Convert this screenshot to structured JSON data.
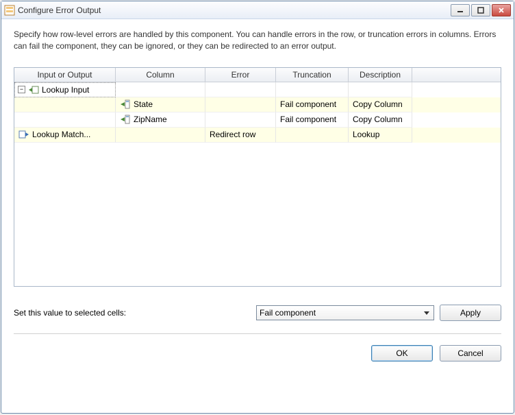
{
  "window": {
    "title": "Configure Error Output"
  },
  "description": "Specify how row-level errors are handled by this component. You can handle errors in the row, or truncation errors in columns. Errors can fail the component, they can be ignored, or they can be redirected to an error output.",
  "grid": {
    "headers": {
      "io": "Input or Output",
      "col": "Column",
      "err": "Error",
      "trunc": "Truncation",
      "desc": "Description"
    },
    "rows": [
      {
        "type": "group",
        "io": "Lookup Input"
      },
      {
        "type": "col",
        "col": "State",
        "trunc": "Fail component",
        "desc": "Copy Column"
      },
      {
        "type": "col",
        "col": "ZipName",
        "trunc": "Fail component",
        "desc": "Copy Column"
      },
      {
        "type": "match",
        "io": "Lookup Match...",
        "err": "Redirect row",
        "desc": "Lookup"
      }
    ]
  },
  "setValue": {
    "label": "Set this value to selected cells:",
    "selected": "Fail component",
    "applyLabel": "Apply"
  },
  "footer": {
    "ok": "OK",
    "cancel": "Cancel"
  }
}
